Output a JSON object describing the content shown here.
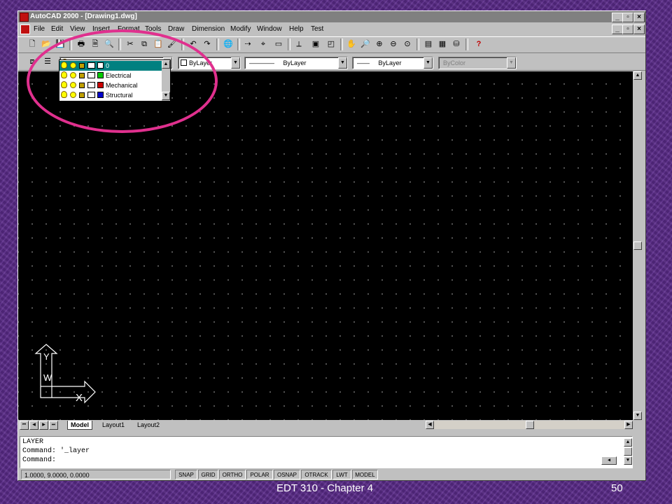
{
  "window": {
    "title": "AutoCAD 2000 - [Drawing1.dwg]",
    "controls": [
      "_",
      "▫",
      "×"
    ]
  },
  "menu": [
    "File",
    "Edit",
    "View",
    "Insert",
    "Format",
    "Tools",
    "Draw",
    "Dimension",
    "Modify",
    "Window",
    "Help",
    "Test"
  ],
  "doc_controls": [
    "_",
    "▫",
    "×"
  ],
  "toolbar_icons": [
    "new-icon",
    "open-icon",
    "save-icon",
    "print-icon",
    "print-preview-icon",
    "find-icon",
    "cut-icon",
    "copy-icon",
    "paste-icon",
    "match-properties-icon",
    "undo-icon",
    "redo-icon",
    "hyperlink-icon",
    "tracking-icon",
    "snap-from-icon",
    "pan-icon",
    "zoom-realtime-icon",
    "zoom-window-icon",
    "zoom-previous-icon",
    "properties-icon",
    "designcenter-icon",
    "dbconnect-icon",
    "help-icon"
  ],
  "properties_bar": {
    "layer_value": "0",
    "color_value": "ByLayer",
    "linetype_value": "ByLayer",
    "lineweight_value": "ByLayer",
    "plotstyle_value": "ByColor",
    "linetype_line": "————",
    "lineweight_line": "——"
  },
  "layer_dropdown": {
    "rows": [
      {
        "name": "0",
        "color": "#ffffff",
        "selected": true
      },
      {
        "name": "Electrical",
        "color": "#00cc00",
        "selected": false
      },
      {
        "name": "Mechanical",
        "color": "#cc0000",
        "selected": false
      },
      {
        "name": "Structural",
        "color": "#0000cc",
        "selected": false
      }
    ]
  },
  "ucs_icon": {
    "y_label": "Y",
    "w_label": "W",
    "x_label": "X"
  },
  "tabs": {
    "model": "Model",
    "layout1": "Layout1",
    "layout2": "Layout2"
  },
  "command_lines": [
    "LAYER",
    "Command:  '_layer",
    "Command:"
  ],
  "status": {
    "coordinates": "1.0000, 9.0000, 0.0000",
    "toggles": [
      "SNAP",
      "GRID",
      "ORTHO",
      "POLAR",
      "OSNAP",
      "OTRACK",
      "LWT",
      "MODEL"
    ]
  },
  "footer": {
    "title": "EDT 310 - Chapter 4",
    "page": "50"
  },
  "colors": {
    "highlight": "#e0308e",
    "background": "#5a2d86",
    "selection": "#008080"
  }
}
